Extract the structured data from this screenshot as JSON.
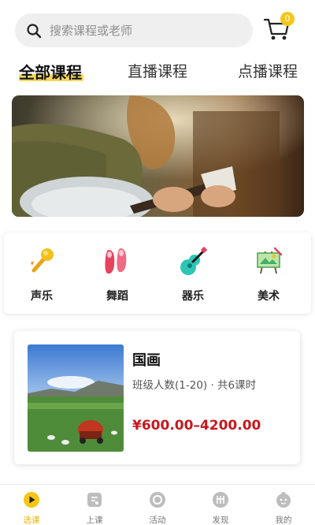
{
  "search": {
    "placeholder": "搜索课程或老师",
    "cart_count": "0"
  },
  "tabs": [
    {
      "label": "全部课程",
      "active": true
    },
    {
      "label": "直播课程",
      "active": false
    },
    {
      "label": "点播课程",
      "active": false
    }
  ],
  "categories": [
    {
      "label": "声乐",
      "icon": "microphone-icon"
    },
    {
      "label": "舞蹈",
      "icon": "ballet-shoes-icon"
    },
    {
      "label": "器乐",
      "icon": "guitar-icon"
    },
    {
      "label": "美术",
      "icon": "easel-icon"
    }
  ],
  "course": {
    "title": "国画",
    "meta": "班级人数(1-20) · 共6课时",
    "price": "¥600.00–4200.00"
  },
  "tabbar": [
    {
      "label": "选课",
      "icon": "play-circle-icon",
      "active": true
    },
    {
      "label": "上课",
      "icon": "music-book-icon",
      "active": false
    },
    {
      "label": "活动",
      "icon": "activity-icon",
      "active": false
    },
    {
      "label": "发现",
      "icon": "discover-icon",
      "active": false
    },
    {
      "label": "我的",
      "icon": "profile-icon",
      "active": false
    }
  ],
  "colors": {
    "accent": "#f5c518",
    "price": "#c6181e",
    "search_bg": "#efefef"
  }
}
